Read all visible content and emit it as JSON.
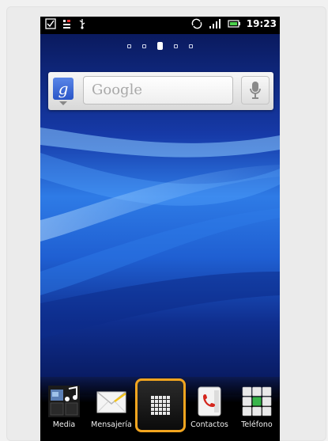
{
  "status_bar": {
    "time": "19:23",
    "icons": [
      "checkbox-icon",
      "sim-icon",
      "usb-icon",
      "rotate-icon",
      "signal-icon",
      "battery-icon"
    ]
  },
  "home_screen": {
    "page_count": 5,
    "current_page": 3
  },
  "search_widget": {
    "placeholder": "Google",
    "logo_letter": "g",
    "mic_icon": "microphone-icon"
  },
  "dock": {
    "items": [
      {
        "label": "Media",
        "icon": "media-icon"
      },
      {
        "label": "Mensajería",
        "icon": "envelope-icon"
      },
      {
        "label": "",
        "icon": "app-grid-icon"
      },
      {
        "label": "Contactos",
        "icon": "contacts-book-icon"
      },
      {
        "label": "Teléfono",
        "icon": "dialpad-icon"
      }
    ]
  },
  "colors": {
    "highlight": "#f2a51f",
    "wallpaper_dark": "#0a1f6e",
    "wallpaper_light": "#3b8cf0"
  }
}
